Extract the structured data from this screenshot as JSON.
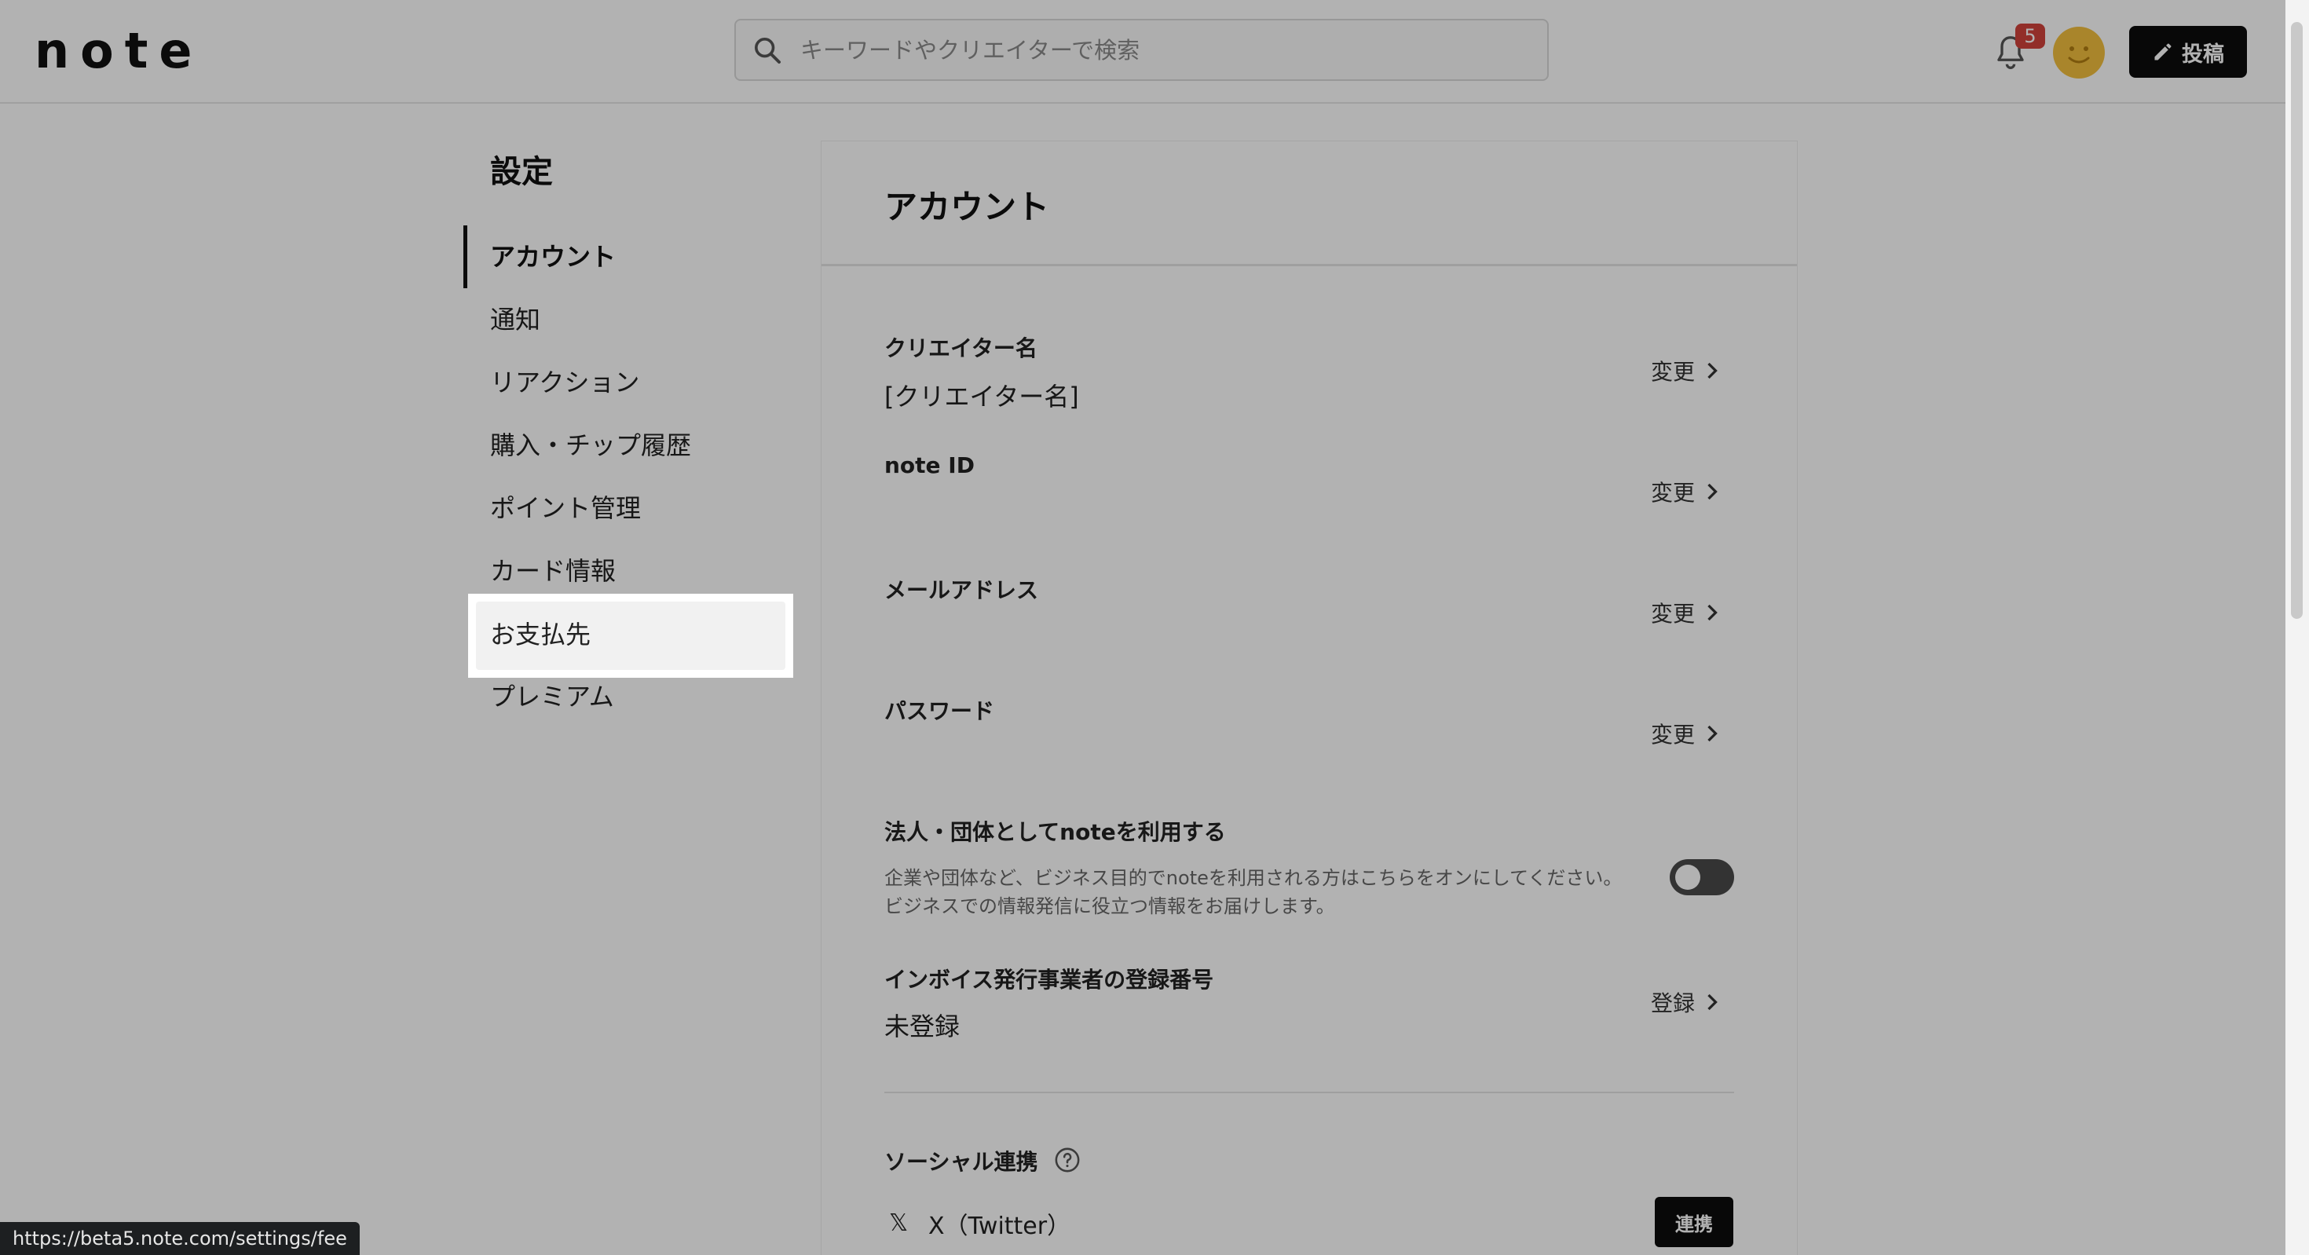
{
  "header": {
    "logo": "note",
    "search_placeholder": "キーワードやクリエイターで検索",
    "notification_count": "5",
    "post_label": "投稿"
  },
  "sidebar": {
    "title": "設定",
    "items": [
      {
        "label": "アカウント",
        "active": true
      },
      {
        "label": "通知"
      },
      {
        "label": "リアクション"
      },
      {
        "label": "購入・チップ履歴"
      },
      {
        "label": "ポイント管理"
      },
      {
        "label": "カード情報"
      },
      {
        "label": "お支払先",
        "hovered": true
      },
      {
        "label": "プレミアム"
      }
    ]
  },
  "main": {
    "title": "アカウント",
    "rows": [
      {
        "label": "クリエイター名",
        "value": "[クリエイター名]",
        "action": "変更"
      },
      {
        "label": "note ID",
        "value": "",
        "action": "変更"
      },
      {
        "label": "メールアドレス",
        "value": "",
        "action": "変更"
      },
      {
        "label": "パスワード",
        "value": "",
        "action": "変更"
      }
    ],
    "corporate": {
      "label": "法人・団体としてnoteを利用する",
      "desc_line1": "企業や団体など、ビジネス目的でnoteを利用される方はこちらをオンにしてください。",
      "desc_line2": "ビジネスでの情報発信に役立つ情報をお届けします。",
      "toggle_on": false
    },
    "invoice": {
      "label": "インボイス発行事業者の登録番号",
      "value": "未登録",
      "action": "登録"
    },
    "social": {
      "label": "ソーシャル連携",
      "services": [
        {
          "name": "X（Twitter）",
          "action": "連携"
        }
      ]
    }
  },
  "status_bar": {
    "url": "https://beta5.note.com/settings/fee"
  },
  "colors": {
    "badge": "#d2433b",
    "avatar": "#f2bf3e",
    "button": "#0c0c0c"
  }
}
